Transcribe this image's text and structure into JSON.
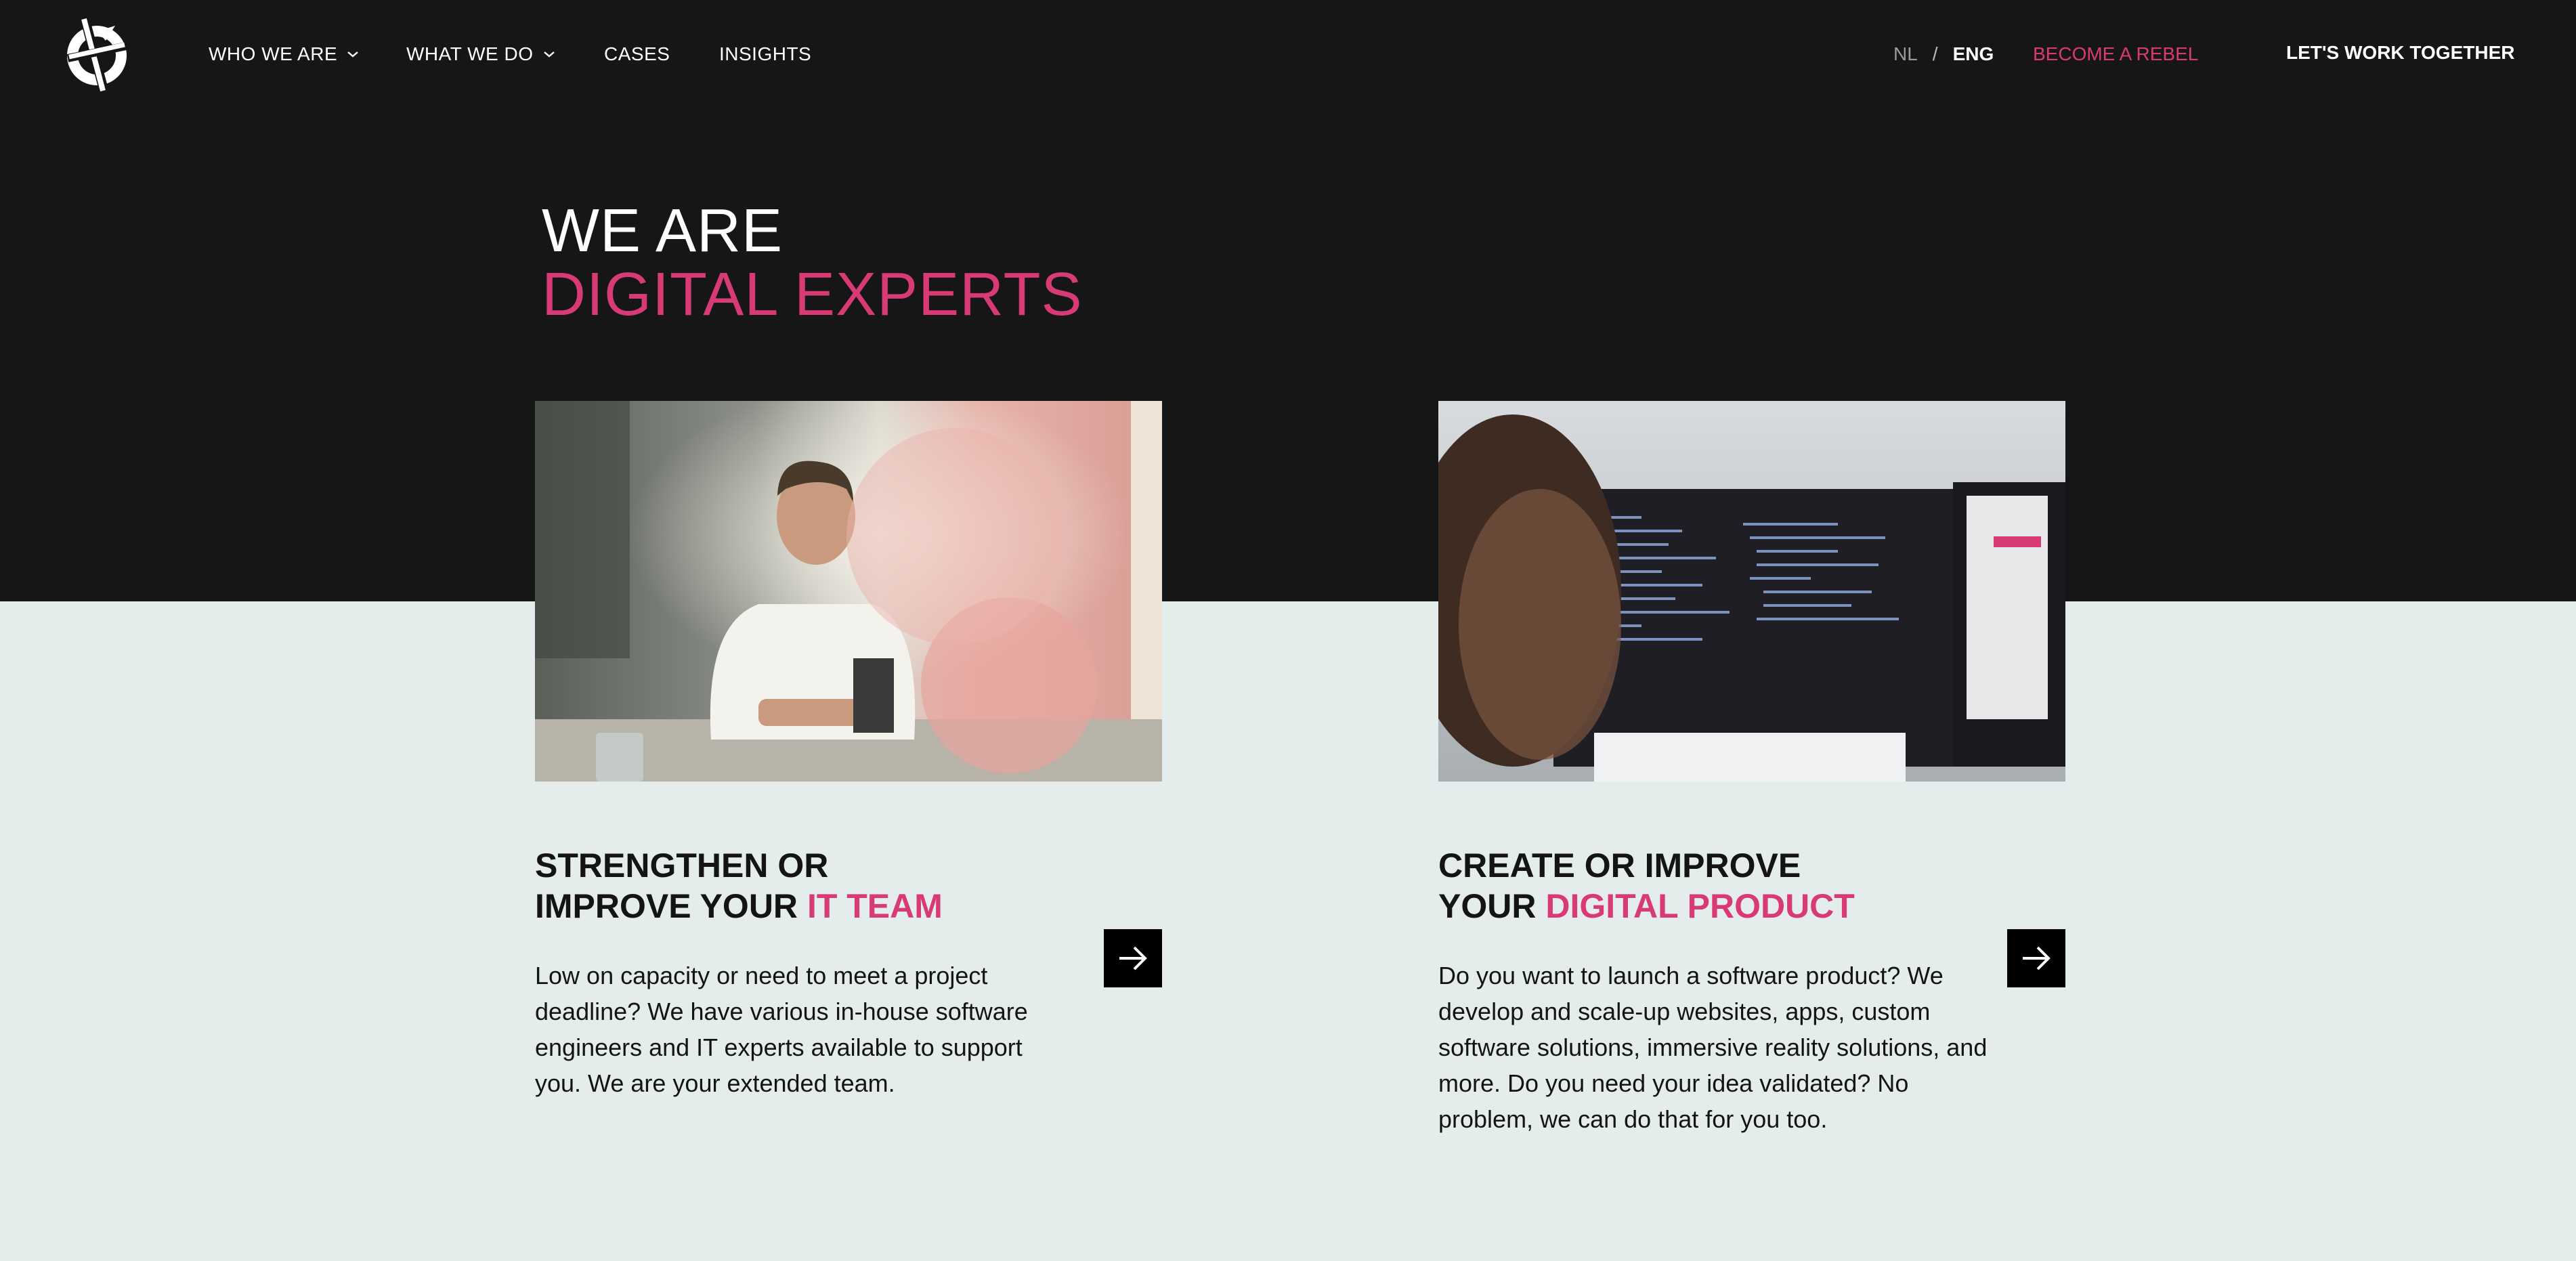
{
  "nav": {
    "logo_icon": "rebel-logo-icon",
    "items": [
      {
        "label": "WHO WE ARE",
        "has_dropdown": true
      },
      {
        "label": "WHAT WE DO",
        "has_dropdown": true
      },
      {
        "label": "CASES",
        "has_dropdown": false
      },
      {
        "label": "INSIGHTS",
        "has_dropdown": false
      }
    ],
    "lang": {
      "nl": "NL",
      "separator": "/",
      "eng": "ENG"
    },
    "become_rebel": "BECOME A REBEL",
    "cta": "LET'S WORK TOGETHER"
  },
  "hero": {
    "line1": "WE ARE",
    "line2": "DIGITAL EXPERTS"
  },
  "cards": [
    {
      "title_line1": "STRENGTHEN OR",
      "title_line2_prefix": "IMPROVE YOUR ",
      "title_highlight": "IT TEAM",
      "text": "Low on capacity or need to meet a project deadline? We have various in-house software engineers and IT experts available to support you. We are your extended team.",
      "image": "man-working-at-laptop-photo"
    },
    {
      "title_line1": "CREATE OR IMPROVE",
      "title_line2_prefix": "YOUR ",
      "title_highlight": "DIGITAL PRODUCT",
      "text": "Do you want to launch a software product? We develop and scale-up websites, apps, custom software solutions, immersive reality solutions, and more. Do you need your idea validated? No problem, we can do that for you too.",
      "image": "developer-coding-on-monitors-photo"
    }
  ],
  "colors": {
    "accent": "#d73a74",
    "dark_bg": "#161616",
    "light_bg": "#e5ecec"
  }
}
